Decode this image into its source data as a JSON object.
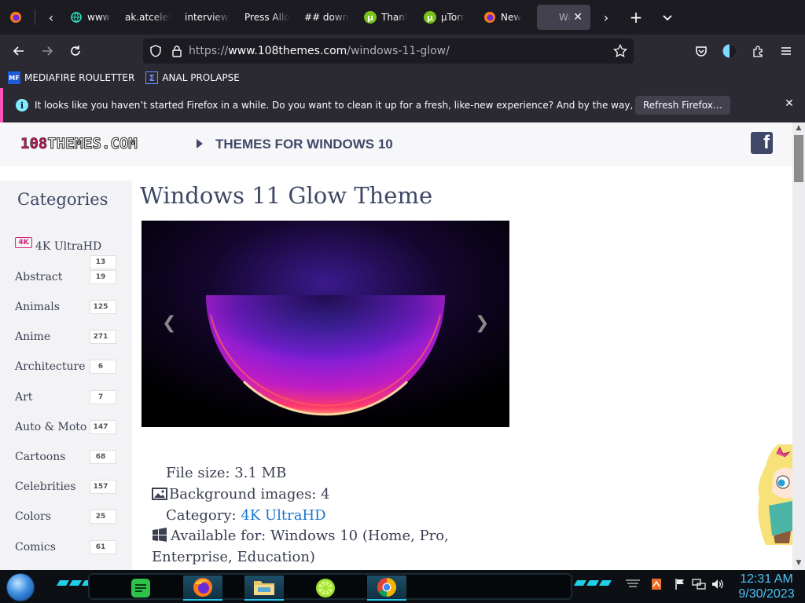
{
  "browser": {
    "tabs": [
      {
        "title": "www.",
        "icon": "globe-icon"
      },
      {
        "title": "ak.atceleb",
        "icon": "none"
      },
      {
        "title": "interviewh",
        "icon": "none"
      },
      {
        "title": "Press Allo",
        "icon": "none"
      },
      {
        "title": "## downl",
        "icon": "none"
      },
      {
        "title": "Thanl",
        "icon": "utorrent-icon"
      },
      {
        "title": "µTorr",
        "icon": "utorrent-icon"
      },
      {
        "title": "New",
        "icon": "firefox-icon"
      },
      {
        "title": "Wi",
        "icon": "none",
        "active": true
      }
    ],
    "url": {
      "scheme": "https://",
      "host": "www.108themes.com",
      "path": "/windows-11-glow/"
    },
    "bookmarks": [
      {
        "label": "MEDIAFIRE ROULETTER",
        "icon": "mf-icon"
      },
      {
        "label": "ANAL PROLAPSE",
        "icon": "sigma-icon"
      }
    ],
    "notification": {
      "message": "It looks like you haven’t started Firefox in a while. Do you want to clean it up for a fresh, like-new experience? And by the way, welcome back!",
      "button": "Refresh Firefox…",
      "accent": "#ff52b8"
    }
  },
  "site": {
    "logo_number": "108",
    "logo_text": "THEMES.COM",
    "section": "THEMES FOR WINDOWS 10",
    "sidebar_title": "Categories",
    "categories": [
      {
        "name": "4K UltraHD",
        "count": "13"
      },
      {
        "name": "Abstract",
        "count": "19"
      },
      {
        "name": "Animals",
        "count": "125"
      },
      {
        "name": "Anime",
        "count": "271"
      },
      {
        "name": "Architecture",
        "count": "6"
      },
      {
        "name": "Art",
        "count": "7"
      },
      {
        "name": "Auto & Moto",
        "count": "147"
      },
      {
        "name": "Cartoons",
        "count": "68"
      },
      {
        "name": "Celebrities",
        "count": "157"
      },
      {
        "name": "Colors",
        "count": "25"
      },
      {
        "name": "Comics",
        "count": "61"
      }
    ],
    "badge_4k": "4K",
    "title": "Windows 11 Glow Theme",
    "details": {
      "file_size": "File size: 3.1 MB",
      "bg_images": "Background images: 4",
      "category_label": "Category: ",
      "category_link": "4K UltraHD",
      "available": "Available for: Windows 10 (Home, Pro,",
      "available_cont": "Enterprise, Education)"
    }
  },
  "taskbar": {
    "time": "12:31 AM",
    "date": "9/30/2023",
    "accent": "#1fd0e8"
  }
}
